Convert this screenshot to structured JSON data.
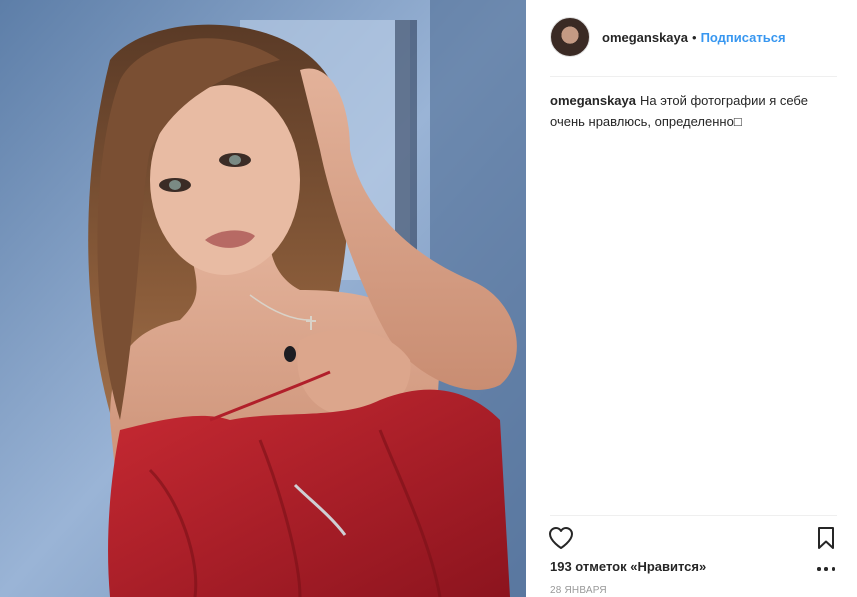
{
  "post": {
    "username": "omeganskaya",
    "separator": "•",
    "follow_label": "Подписаться",
    "caption_username": "omeganskaya",
    "caption_text": "На этой фотографии я себе очень нравлюсь, определенно□",
    "likes_text": "193 отметок «Нравится»",
    "date": "28 ЯНВАРЯ"
  },
  "icons": {
    "like": "heart-icon",
    "save": "bookmark-icon",
    "more": "more-dots-icon",
    "avatar": "avatar"
  },
  "colors": {
    "follow": "#3897f0",
    "text": "#262626",
    "muted": "#999999",
    "dress": "#b11f2a",
    "background": "#7f9cc2"
  }
}
